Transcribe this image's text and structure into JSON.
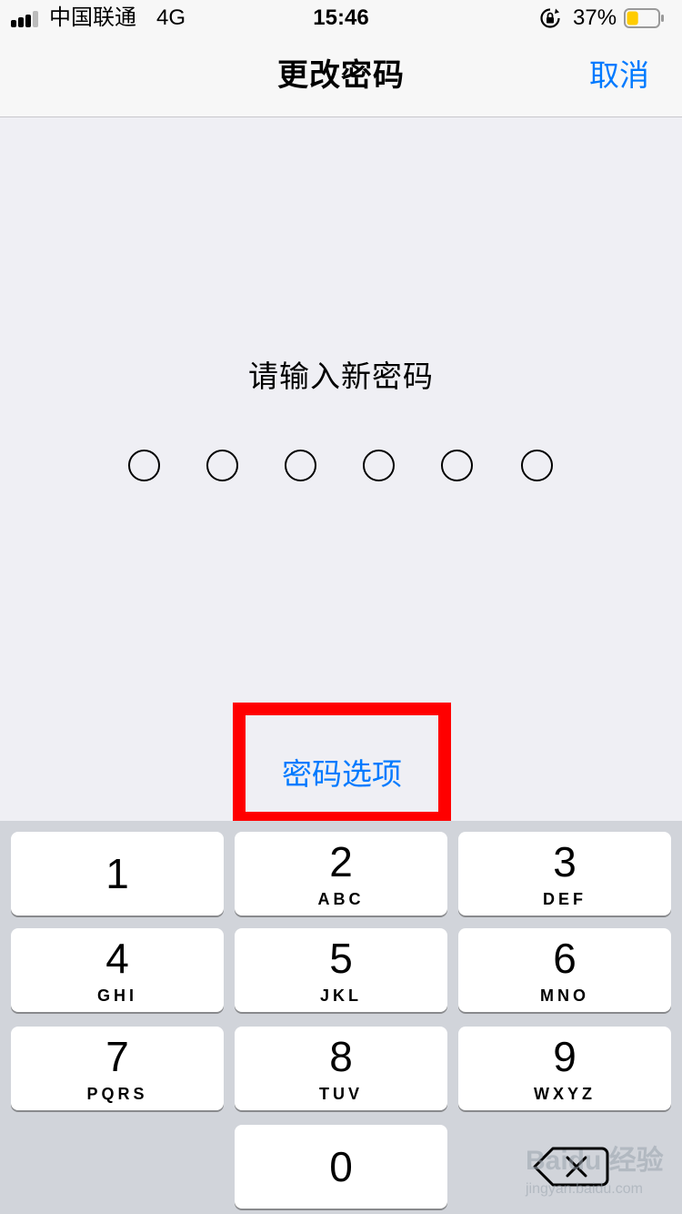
{
  "status_bar": {
    "carrier": "中国联通",
    "network": "4G",
    "time": "15:46",
    "battery_percent": "37%",
    "battery_level": 0.37,
    "battery_color": "#ffcc00",
    "signal_bars_filled": 3,
    "signal_bars_total": 4,
    "icons": [
      "signal-icon",
      "rotation-lock-icon",
      "battery-icon"
    ]
  },
  "nav": {
    "title": "更改密码",
    "cancel_label": "取消"
  },
  "main": {
    "prompt": "请输入新密码",
    "passcode_length": 6,
    "options_label": "密码选项",
    "highlight_color": "#ff0000"
  },
  "keypad": {
    "keys": [
      {
        "digit": "1",
        "letters": ""
      },
      {
        "digit": "2",
        "letters": "ABC"
      },
      {
        "digit": "3",
        "letters": "DEF"
      },
      {
        "digit": "4",
        "letters": "GHI"
      },
      {
        "digit": "5",
        "letters": "JKL"
      },
      {
        "digit": "6",
        "letters": "MNO"
      },
      {
        "digit": "7",
        "letters": "PQRS"
      },
      {
        "digit": "8",
        "letters": "TUV"
      },
      {
        "digit": "9",
        "letters": "WXYZ"
      },
      {
        "digit": "0",
        "letters": ""
      }
    ],
    "delete_icon": "delete-backspace-icon"
  },
  "watermark": {
    "brand": "Baidu 经验",
    "url": "jingyan.baidu.com"
  },
  "colors": {
    "accent": "#007aff",
    "background": "#efeff4",
    "keypad_background": "#d1d4da"
  }
}
